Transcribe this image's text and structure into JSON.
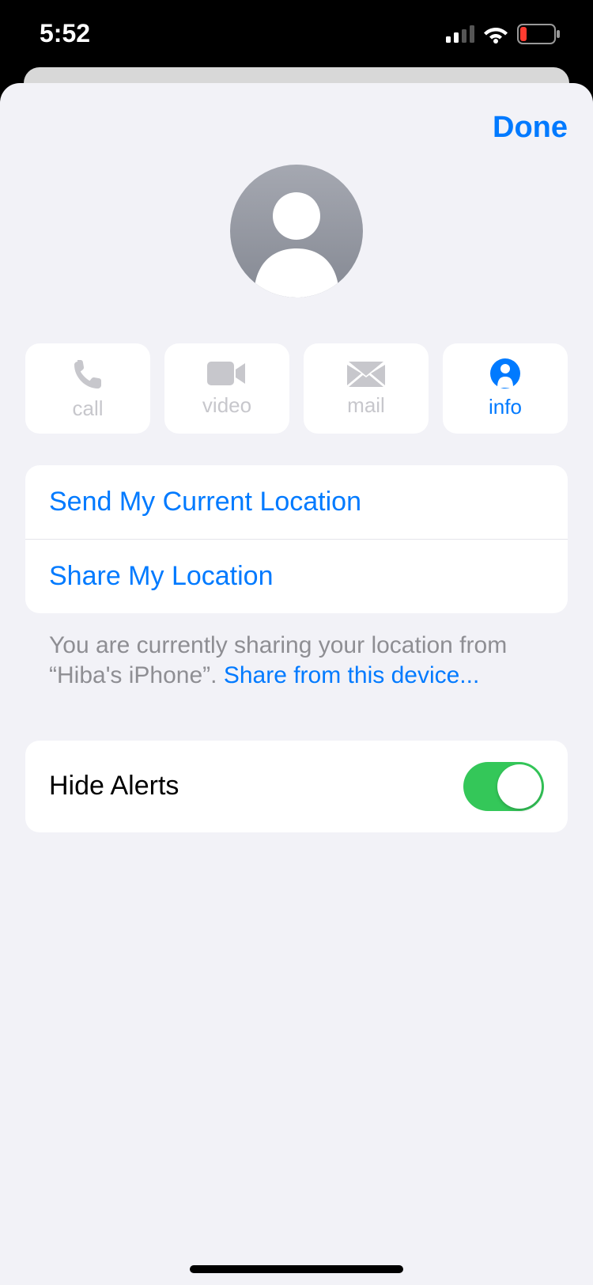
{
  "status": {
    "time": "5:52"
  },
  "header": {
    "done": "Done"
  },
  "actions": {
    "call": "call",
    "video": "video",
    "mail": "mail",
    "info": "info"
  },
  "location": {
    "send": "Send My Current Location",
    "share": "Share My Location",
    "footer_prefix": "You are currently sharing your location from “Hiba's iPhone”. ",
    "footer_link": "Share from this device..."
  },
  "alerts": {
    "label": "Hide Alerts",
    "enabled": true
  }
}
